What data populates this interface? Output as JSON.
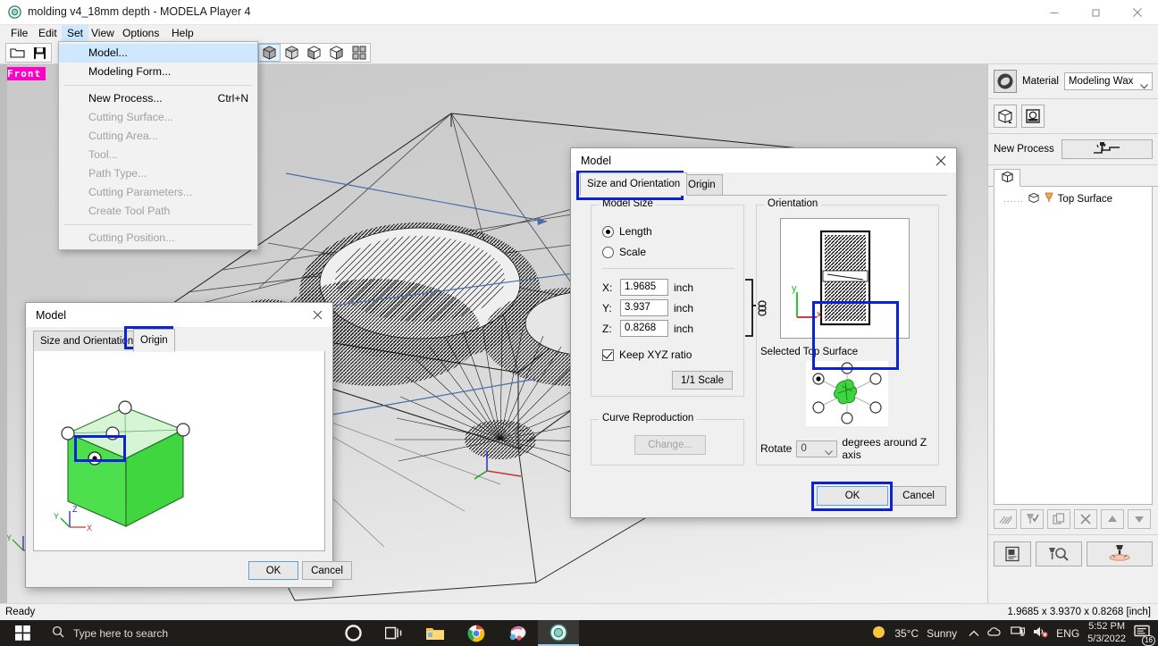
{
  "window": {
    "title": "molding v4_18mm depth  - MODELA Player 4",
    "app_icon": "modela-disc-icon",
    "minimize": "minimize-icon",
    "maximize": "maximize-icon",
    "close": "close-icon"
  },
  "menubar": {
    "items": [
      "File",
      "Edit",
      "Set",
      "View",
      "Options",
      "Help"
    ],
    "active": "Set"
  },
  "toolbar": {
    "file_buttons": [
      "open-folder-icon",
      "save-disk-icon"
    ],
    "view_buttons": [
      "view-iso-icon",
      "view-top-icon",
      "view-front-icon",
      "view-right-icon",
      "view-four-icon"
    ],
    "selected_view_index": 0
  },
  "viewport": {
    "label": "Front",
    "axis_glyph": "xyz-axis-icon"
  },
  "set_menu": {
    "items": [
      {
        "label": "Model...",
        "accel": "",
        "state": "highlighted"
      },
      {
        "label": "Modeling Form...",
        "accel": "",
        "state": "enabled"
      },
      {
        "separator": true
      },
      {
        "label": "New Process...",
        "accel": "Ctrl+N",
        "state": "enabled"
      },
      {
        "label": "Cutting Surface...",
        "accel": "",
        "state": "disabled"
      },
      {
        "label": "Cutting Area...",
        "accel": "",
        "state": "disabled"
      },
      {
        "label": "Tool...",
        "accel": "",
        "state": "disabled"
      },
      {
        "label": "Path Type...",
        "accel": "",
        "state": "disabled"
      },
      {
        "label": "Cutting Parameters...",
        "accel": "",
        "state": "disabled"
      },
      {
        "label": "Create Tool Path",
        "accel": "",
        "state": "disabled"
      },
      {
        "separator": true
      },
      {
        "label": "Cutting Position...",
        "accel": "",
        "state": "disabled"
      }
    ]
  },
  "model_dialog": {
    "title": "Model",
    "close": "close-icon",
    "tabs": [
      {
        "label": "Size and Orientation",
        "selected": true
      },
      {
        "label": "Origin",
        "selected": false
      }
    ],
    "model_size": {
      "group_label": "Model Size",
      "radio_length": "Length",
      "radio_scale": "Scale",
      "selected_radio": "Length",
      "fields": [
        {
          "label": "X:",
          "value": "1.9685",
          "unit": "inch"
        },
        {
          "label": "Y:",
          "value": "3.937",
          "unit": "inch"
        },
        {
          "label": "Z:",
          "value": "0.8268",
          "unit": "inch"
        }
      ],
      "link_icon": "chain-link-icon",
      "keep_ratio_label": "Keep XYZ ratio",
      "keep_ratio_checked": true,
      "scale_button": "1/1 Scale"
    },
    "curve_reproduction": {
      "group_label": "Curve Reproduction",
      "change_button": "Change...",
      "change_enabled": false
    },
    "orientation": {
      "group_label": "Orientation",
      "preview_axis_x": "x",
      "preview_axis_y": "y",
      "selected_top_surface_label": "Selected Top Surface",
      "selected_position": "left",
      "rotate_label": "Rotate",
      "rotate_value": "0",
      "rotate_suffix": "degrees around Z axis"
    },
    "buttons": {
      "ok": "OK",
      "cancel": "Cancel"
    }
  },
  "origin_dialog": {
    "title": "Model",
    "close": "close-icon",
    "tabs": [
      {
        "label": "Size and Orientation",
        "selected": false
      },
      {
        "label": "Origin",
        "selected": true
      }
    ],
    "axis_labels": {
      "x": "X",
      "y": "Y",
      "z": "Z"
    },
    "buttons": {
      "ok": "OK",
      "cancel": "Cancel"
    }
  },
  "right_panel": {
    "material_icon": "material-brush-icon",
    "material_label": "Material",
    "material_value": "Modeling Wax",
    "shape_buttons": [
      "model-box-icon",
      "surface-disc-icon"
    ],
    "new_process_label": "New Process",
    "new_process_icon": "tool-path-icon",
    "tree_tab_icon": "model-cube-icon",
    "tree_items": [
      {
        "dots": "......",
        "icon": "process-cube-icon",
        "tool_icon": "endmill-icon",
        "label": "Top Surface"
      }
    ],
    "process_tools": [
      "preview-cut-icon",
      "check-tool-icon",
      "duplicate-icon",
      "delete-x-icon",
      "move-up-icon",
      "move-down-icon"
    ],
    "bottom_buttons": [
      "print-preview-icon",
      "tool-search-icon",
      "cut-start-icon"
    ]
  },
  "status_bar": {
    "ready": "Ready",
    "dimensions": "1.9685 x 3.9370 x 0.8268 [inch]"
  },
  "taskbar": {
    "start": "windows-start-icon",
    "search_icon": "search-icon",
    "search_placeholder": "Type here to search",
    "pinned": [
      "cortana-icon",
      "task-view-icon",
      "file-explorer-icon",
      "chrome-icon",
      "snip-sketch-icon",
      "modela-player-icon"
    ],
    "weather_icon": "sun-icon",
    "weather_temp": "35°C",
    "weather_desc": "Sunny",
    "chevron": "show-hidden-icons-icon",
    "tray": [
      "onedrive-icon",
      "network-icon",
      "volume-muted-icon"
    ],
    "language": "ENG",
    "time": "5:52 PM",
    "date": "5/3/2022",
    "notifications_icon": "action-center-icon",
    "notifications_count": "16"
  },
  "colors": {
    "accent_highlight": "#0b22d8",
    "menu_selection": "#cde8ff",
    "view_label_bg": "#ff00c8",
    "green_model": "#4ddf4d"
  }
}
